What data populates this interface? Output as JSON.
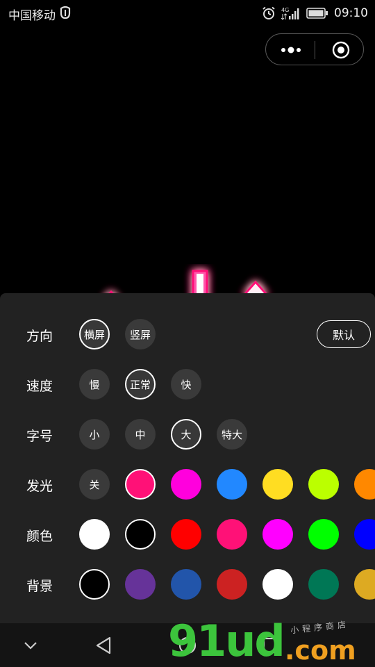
{
  "status_bar": {
    "carrier": "中国移动",
    "time": "09:10",
    "network": "4G"
  },
  "panel": {
    "default_button": "默认",
    "rows": [
      {
        "label": "方向",
        "options": [
          "横屏",
          "竖屏"
        ],
        "selected": 0
      },
      {
        "label": "速度",
        "options": [
          "慢",
          "正常",
          "快"
        ],
        "selected": 1
      },
      {
        "label": "字号",
        "options": [
          "小",
          "中",
          "大",
          "特大"
        ],
        "selected": 2
      },
      {
        "label": "发光",
        "off_label": "关",
        "colors": [
          "#ff1177",
          "#ff00dd",
          "#2288ff",
          "#ffdd22",
          "#bbff00",
          "#ff8800"
        ],
        "selected": 0
      },
      {
        "label": "颜色",
        "colors": [
          "#ffffff",
          "#000000",
          "#ff0000",
          "#ff1177",
          "#ff00ff",
          "#00ff00",
          "#0000ff"
        ],
        "selected": 1
      },
      {
        "label": "背景",
        "colors": [
          "#000000",
          "#663399",
          "#2255aa",
          "#cc2222",
          "#ffffff",
          "#007755",
          "#ddaa22"
        ],
        "selected": 0
      }
    ]
  },
  "watermark": {
    "main": "91ud",
    "com": ".com",
    "sub": "小程序商店"
  },
  "icons": {
    "alarm": "alarm-icon",
    "signal": "signal-icon",
    "battery": "battery-icon",
    "capsule_more": "more-dots-icon",
    "capsule_close": "target-close-icon",
    "nav_down": "chevron-down-icon",
    "nav_back": "triangle-back-icon",
    "nav_home": "circle-home-icon",
    "nav_recent": "square-recent-icon"
  }
}
